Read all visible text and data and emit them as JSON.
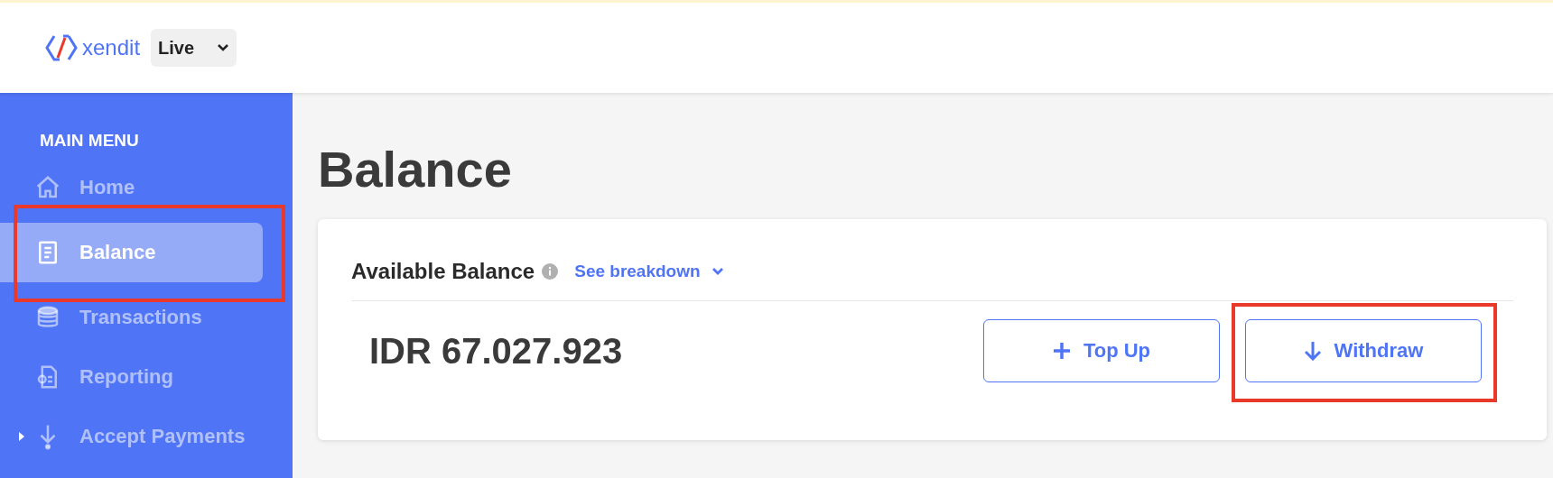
{
  "header": {
    "logo": "xendit",
    "mode_select": {
      "value": "Live"
    }
  },
  "sidebar": {
    "heading": "MAIN MENU",
    "items": [
      {
        "label": "Home",
        "kind": "link",
        "selected": false,
        "highlighted": false
      },
      {
        "label": "Balance",
        "kind": "link",
        "selected": true,
        "highlighted": true
      },
      {
        "label": "Transactions",
        "kind": "link",
        "selected": false,
        "highlighted": false
      },
      {
        "label": "Reporting",
        "kind": "link",
        "selected": false,
        "highlighted": false
      },
      {
        "label": "Accept Payments",
        "kind": "group",
        "selected": false,
        "highlighted": false
      }
    ]
  },
  "page": {
    "title": "Balance"
  },
  "balance_card": {
    "label": "Available Balance",
    "breakdown_link": "See breakdown",
    "amount": "IDR 67.027.923",
    "buttons": [
      {
        "label": "Top Up",
        "kind": "add",
        "highlighted": false
      },
      {
        "label": "Withdraw",
        "kind": "withdraw",
        "highlighted": true
      }
    ]
  }
}
